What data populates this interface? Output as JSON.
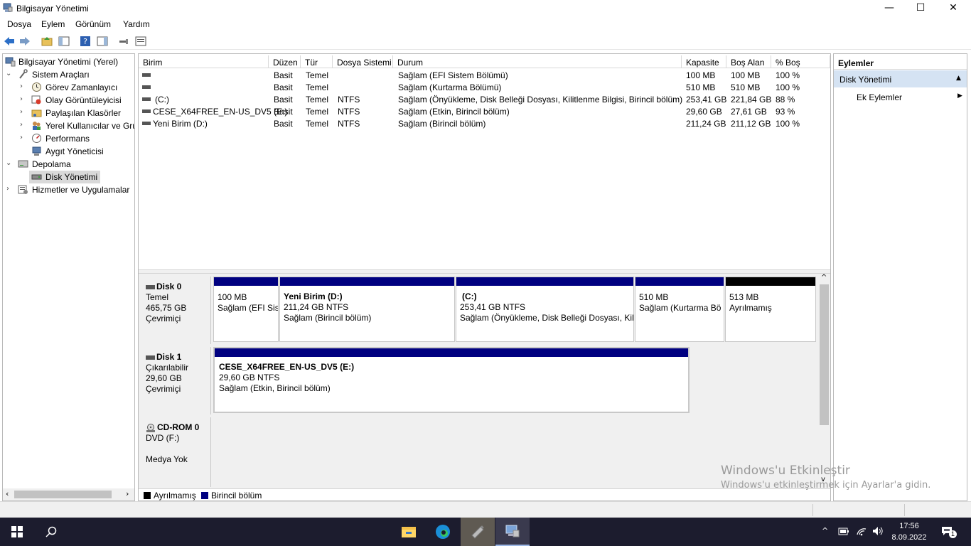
{
  "window": {
    "title": "Bilgisayar Yönetimi",
    "minimize": "—",
    "maximize": "☐",
    "close": "✕"
  },
  "menu": [
    "Dosya",
    "Eylem",
    "Görünüm",
    "Yardım"
  ],
  "tree": {
    "root": "Bilgisayar Yönetimi (Yerel)",
    "system_tools": "Sistem Araçları",
    "task_scheduler": "Görev Zamanlayıcı",
    "event_viewer": "Olay Görüntüleyicisi",
    "shared_folders": "Paylaşılan Klasörler",
    "local_users": "Yerel Kullanıcılar ve Gru",
    "performance": "Performans",
    "device_manager": "Aygıt Yöneticisi",
    "storage": "Depolama",
    "disk_management": "Disk Yönetimi",
    "services": "Hizmetler ve Uygulamalar"
  },
  "grid": {
    "headers": [
      "Birim",
      "Düzen",
      "Tür",
      "Dosya Sistemi",
      "Durum",
      "Kapasite",
      "Boş Alan",
      "% Boş"
    ],
    "rows": [
      [
        "",
        "Basit",
        "Temel",
        "",
        "Sağlam (EFI Sistem Bölümü)",
        "100 MB",
        "100 MB",
        "100 %"
      ],
      [
        "",
        "Basit",
        "Temel",
        "",
        "Sağlam (Kurtarma Bölümü)",
        "510 MB",
        "510 MB",
        "100 %"
      ],
      [
        "(C:)",
        "Basit",
        "Temel",
        "NTFS",
        "Sağlam (Önyükleme, Disk Belleği Dosyası, Kilitlenme Bilgisi, Birincil bölüm)",
        "253,41 GB",
        "221,84 GB",
        "88 %"
      ],
      [
        "CESE_X64FREE_EN-US_DV5 (E:)",
        "Basit",
        "Temel",
        "NTFS",
        "Sağlam (Etkin, Birincil bölüm)",
        "29,60 GB",
        "27,61 GB",
        "93 %"
      ],
      [
        "Yeni Birim (D:)",
        "Basit",
        "Temel",
        "NTFS",
        "Sağlam (Birincil bölüm)",
        "211,24 GB",
        "211,12 GB",
        "100 %"
      ]
    ]
  },
  "disks": {
    "disk0": {
      "name": "Disk 0",
      "type": "Temel",
      "size": "465,75 GB",
      "status": "Çevrimiçi"
    },
    "disk1": {
      "name": "Disk 1",
      "type": "Çıkarılabilir",
      "size": "29,60 GB",
      "status": "Çevrimiçi"
    },
    "cdrom": {
      "name": "CD-ROM 0",
      "type": "DVD (F:)",
      "status": "Medya Yok"
    }
  },
  "partitions": {
    "p_efi": {
      "line1": "100 MB",
      "line2": "Sağlam (EFI Sis"
    },
    "p_d": {
      "title": "Yeni Birim  (D:)",
      "line1": "211,24 GB NTFS",
      "line2": "Sağlam (Birincil bölüm)"
    },
    "p_c": {
      "title": "(C:)",
      "line1": "253,41 GB NTFS",
      "line2": "Sağlam (Önyükleme, Disk Belleği Dosyası, Kil"
    },
    "p_rec": {
      "line1": "510 MB",
      "line2": "Sağlam (Kurtarma Bö"
    },
    "p_unalloc": {
      "line1": "513 MB",
      "line2": "Ayrılmamış"
    },
    "p_e": {
      "title": "CESE_X64FREE_EN-US_DV5  (E:)",
      "line1": "29,60 GB NTFS",
      "line2": "Sağlam (Etkin, Birincil bölüm)"
    }
  },
  "legend": {
    "unallocated": "Ayrılmamış",
    "primary": "Birincil bölüm"
  },
  "actions": {
    "header": "Eylemler",
    "section": "Disk Yönetimi",
    "more": "Ek Eylemler"
  },
  "watermark": {
    "title": "Windows'u Etkinleştir",
    "subtitle": "Windows'u etkinleştirmek için Ayarlar'a gidin."
  },
  "taskbar": {
    "time": "17:56",
    "date": "8.09.2022",
    "notifications": "1"
  },
  "colors": {
    "primary_partition": "#000080",
    "unallocated": "#000000",
    "selection": "#cce8ff",
    "actions_header": "#d5e3f3"
  }
}
